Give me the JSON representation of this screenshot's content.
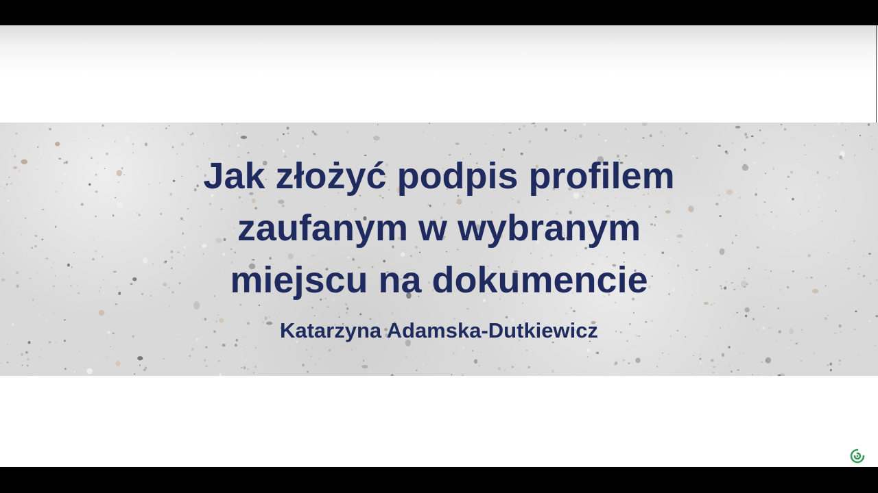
{
  "slide": {
    "title_lines": [
      "Jak złożyć podpis profilem",
      "zaufanym w wybranym",
      "miejscu na dokumencie"
    ],
    "author": "Katarzyna Adamska-Dutkiewicz"
  },
  "colors": {
    "text": "#1f2b5e",
    "band": "#d9d9d9",
    "letterbox": "#000000",
    "logo": "#3a9a5c"
  },
  "icons": {
    "brand_logo": "brand-logo-icon"
  }
}
